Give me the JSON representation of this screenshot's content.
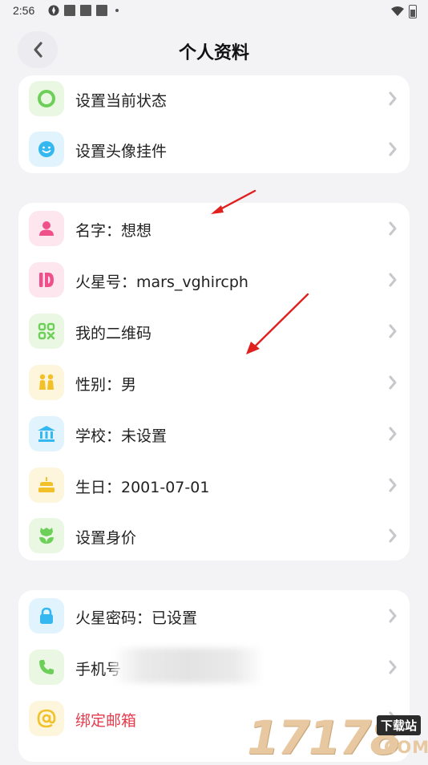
{
  "status_bar": {
    "time": "2:56"
  },
  "header": {
    "title": "个人资料"
  },
  "section1": [
    {
      "label": "设置当前状态",
      "icon": "status-ring-icon"
    },
    {
      "label": "设置头像挂件",
      "icon": "smiley-icon"
    }
  ],
  "section2": [
    {
      "label": "名字：想想",
      "icon": "person-icon"
    },
    {
      "label": "火星号：mars_vghircph",
      "icon": "id-icon"
    },
    {
      "label": "我的二维码",
      "icon": "qrcode-icon"
    },
    {
      "label": "性别：男",
      "icon": "gender-icon"
    },
    {
      "label": "学校：未设置",
      "icon": "school-icon"
    },
    {
      "label": "生日：2001-07-01",
      "icon": "cake-icon"
    },
    {
      "label": "设置身价",
      "icon": "flower-icon"
    }
  ],
  "section3": [
    {
      "label": "火星密码：已设置",
      "icon": "lock-icon"
    },
    {
      "label": "手机号",
      "icon": "phone-icon"
    },
    {
      "label": "绑定邮箱",
      "icon": "at-icon"
    }
  ],
  "watermark": {
    "digits": "17178",
    "box": "下载站",
    "suffix": ".COM"
  },
  "colors": {
    "background": "#f3f3f6",
    "card": "#ffffff",
    "green_icon": "#6ccf57",
    "pink_icon": "#f0508a",
    "blue_icon": "#35b7f0",
    "yellow_icon": "#f2c12a",
    "red_text": "#e53b4c",
    "annotation_arrow": "#e0201f"
  }
}
